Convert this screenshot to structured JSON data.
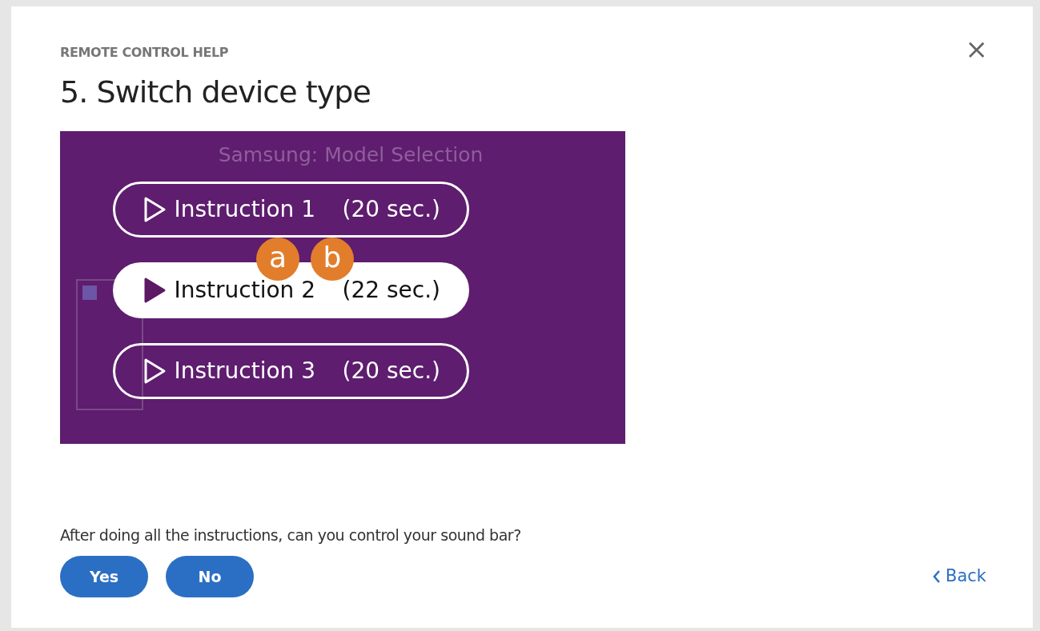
{
  "dialog": {
    "eyebrow": "REMOTE CONTROL HELP",
    "title": "5. Switch device type",
    "close": "×"
  },
  "screen": {
    "title": "Samsung: Model Selection",
    "instructions": [
      {
        "label": "Instruction 1",
        "duration": "(20 sec.)",
        "selected": false
      },
      {
        "label": "Instruction 2",
        "duration": "(22 sec.)",
        "selected": true
      },
      {
        "label": "Instruction 3",
        "duration": "(20 sec.)",
        "selected": false
      }
    ],
    "badges": [
      "a",
      "b"
    ]
  },
  "question": "After doing all the instructions, can you control your sound bar?",
  "answers": [
    "Yes",
    "No"
  ],
  "back": "Back"
}
